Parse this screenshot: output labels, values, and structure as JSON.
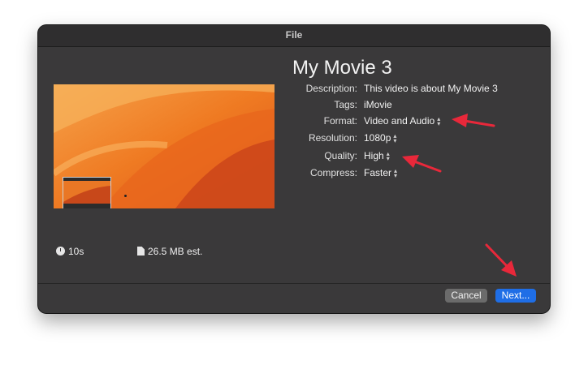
{
  "window": {
    "title": "File"
  },
  "movie": {
    "title": "My Movie 3"
  },
  "properties": [
    {
      "label": "Description:",
      "value": "This video is about My Movie 3",
      "popup": false
    },
    {
      "label": "Tags:",
      "value": "iMovie",
      "popup": false
    },
    {
      "label": "Format:",
      "value": "Video and Audio",
      "popup": true
    },
    {
      "label": "Resolution:",
      "value": "1080p",
      "popup": true
    },
    {
      "label": "Quality:",
      "value": "High",
      "popup": true
    },
    {
      "label": "Compress:",
      "value": "Faster",
      "popup": true
    }
  ],
  "footer": {
    "duration": "10s",
    "size": "26.5 MB est."
  },
  "buttons": {
    "cancel": "Cancel",
    "next": "Next..."
  },
  "colors": {
    "accent": "#1f6ee6",
    "annotation_arrow": "#e8283a",
    "dialog_bg": "#3a393a"
  }
}
